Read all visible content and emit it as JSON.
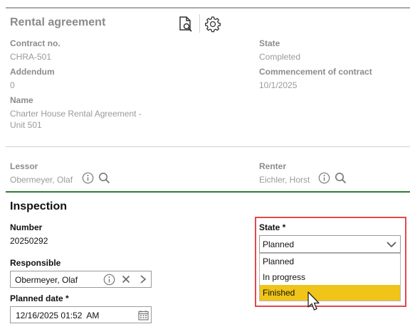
{
  "header": {
    "title": "Rental agreement"
  },
  "contract": {
    "contract_no_label": "Contract no.",
    "contract_no": "CHRA-501",
    "addendum_label": "Addendum",
    "addendum": "0",
    "name_label": "Name",
    "name_line1": "Charter House Rental Agreement -",
    "name_line2": "Unit 501",
    "state_label": "State",
    "state": "Completed",
    "commencement_label": "Commencement of contract",
    "commencement": "10/1/2025"
  },
  "parties": {
    "lessor_label": "Lessor",
    "lessor": "Obermeyer, Olaf",
    "renter_label": "Renter",
    "renter": "Eichler, Horst"
  },
  "inspection": {
    "title": "Inspection",
    "number_label": "Number",
    "number": "20250292",
    "responsible_label": "Responsible",
    "responsible": "Obermeyer, Olaf",
    "planned_date_label": "Planned date *",
    "planned_date": "12/16/2025 01:52  AM",
    "state_label": "State *",
    "state_value": "Planned",
    "state_options": [
      "Planned",
      "In progress",
      "Finished"
    ],
    "highlighted_option": "Finished"
  },
  "colors": {
    "accent_green": "#2e7d32",
    "highlight": "#f0c419",
    "focus_red": "#e04a4a"
  }
}
